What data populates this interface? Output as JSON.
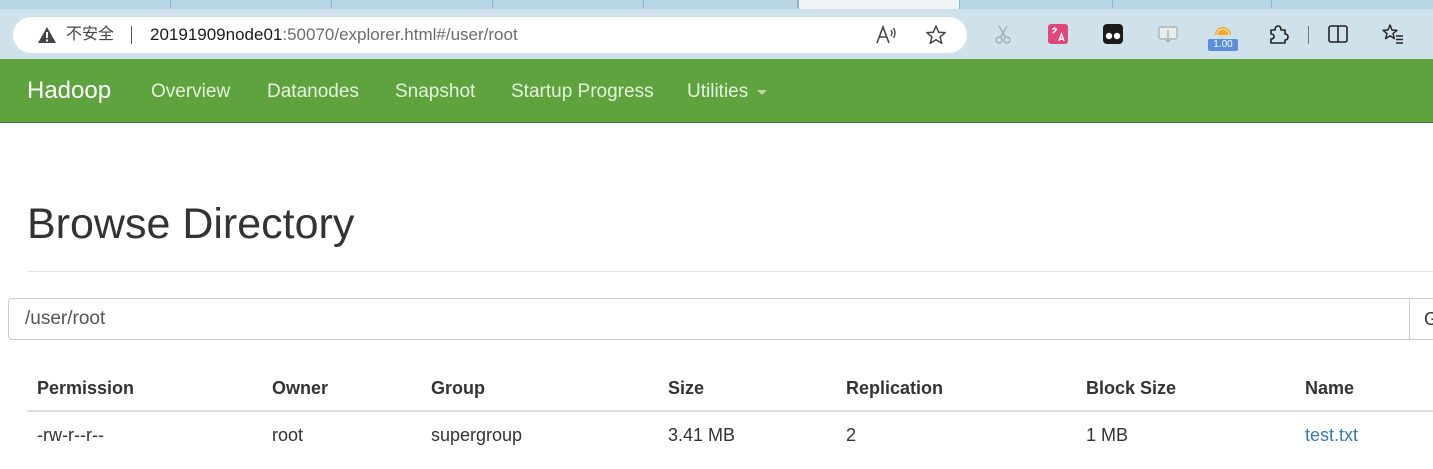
{
  "browser": {
    "security_label": "不安全",
    "url_host": "20191909node01",
    "url_rest": ":50070/explorer.html#/user/root",
    "extension_badge": "1.00",
    "icons": [
      "warning-icon",
      "read-aloud-icon",
      "favorite-star-icon",
      "scissors-extension-icon",
      "translate-extension-icon",
      "tampermonkey-extension-icon",
      "download-extension-icon",
      "weather-extension-icon",
      "extensions-puzzle-icon",
      "split-screen-icon",
      "favorites-list-icon"
    ]
  },
  "navbar": {
    "brand": "Hadoop",
    "items": [
      "Overview",
      "Datanodes",
      "Snapshot",
      "Startup Progress",
      "Utilities"
    ],
    "background": "#5fa33e"
  },
  "page": {
    "title": "Browse Directory",
    "path_value": "/user/root",
    "go_label": "Go"
  },
  "table": {
    "headers": [
      "Permission",
      "Owner",
      "Group",
      "Size",
      "Replication",
      "Block Size",
      "Name"
    ],
    "rows": [
      [
        "-rw-r--r--",
        "root",
        "supergroup",
        "3.41 MB",
        "2",
        "1 MB",
        "test.txt"
      ]
    ],
    "link_color": "#337ab7"
  }
}
